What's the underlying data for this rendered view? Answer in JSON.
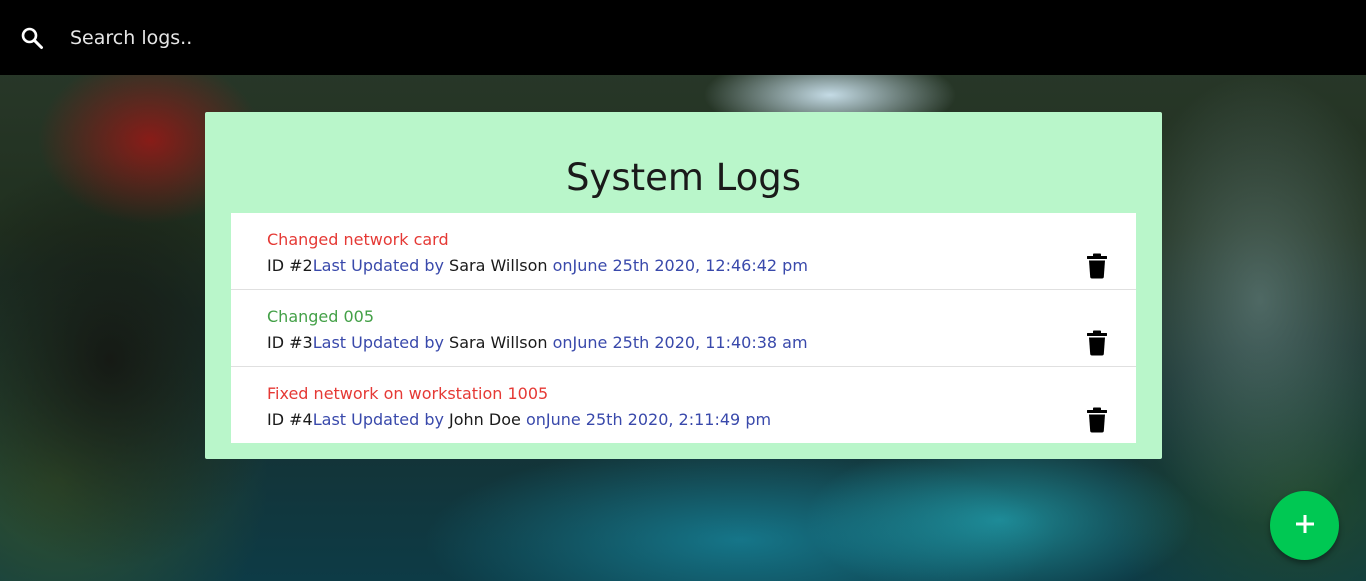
{
  "search": {
    "placeholder": "Search logs.."
  },
  "title": "System Logs",
  "logs": [
    {
      "message": "Changed network card",
      "attention": true,
      "id_label": "ID #2",
      "updated_label": "Last Updated by ",
      "tech": "Sara Willson",
      "on_label": " on",
      "date": "June 25th 2020, 12:46:42 pm"
    },
    {
      "message": "Changed 005",
      "attention": false,
      "id_label": "ID #3",
      "updated_label": "Last Updated by ",
      "tech": "Sara Willson",
      "on_label": " on",
      "date": "June 25th 2020, 11:40:38 am"
    },
    {
      "message": "Fixed network on workstation 1005",
      "attention": true,
      "id_label": "ID #4",
      "updated_label": "Last Updated by ",
      "tech": "John Doe",
      "on_label": " on",
      "date": "June 25th 2020, 2:11:49 pm"
    }
  ],
  "icons": {
    "search": "search-icon",
    "delete": "trash-icon",
    "add": "plus-icon"
  },
  "colors": {
    "topbar": "#000000",
    "panel": "#b9f6ca",
    "attention": "#e53935",
    "normal": "#43a047",
    "meta": "#3949ab",
    "fab": "#00c853"
  }
}
